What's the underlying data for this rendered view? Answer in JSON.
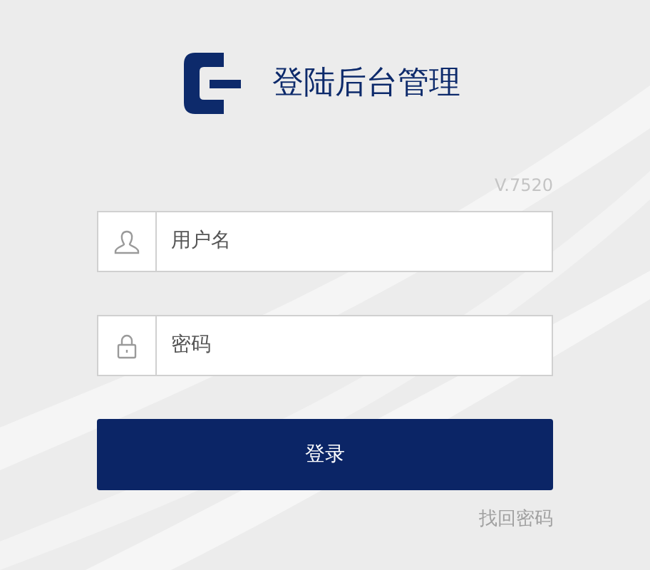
{
  "title": "登陆后台管理",
  "version": "V.7520",
  "fields": [
    {
      "kind": "user",
      "placeholder": "用户名"
    },
    {
      "kind": "password",
      "placeholder": "密码"
    }
  ],
  "login_button": "登录",
  "forgot_link": "找回密码"
}
